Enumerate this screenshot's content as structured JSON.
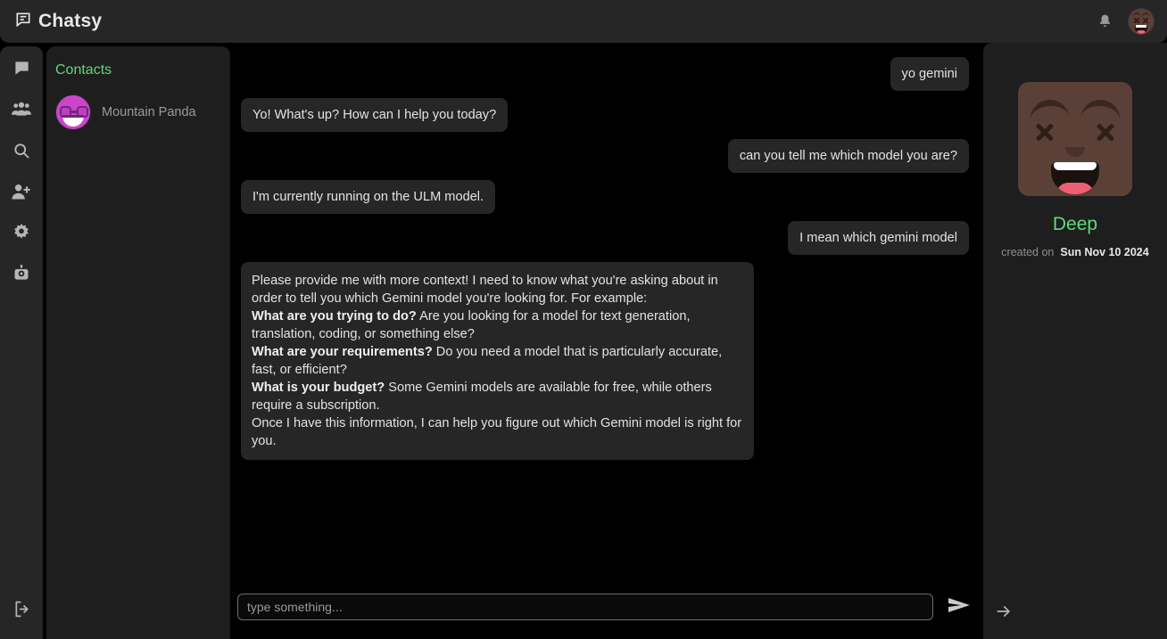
{
  "app": {
    "brand": "Chatsy",
    "brand_icon": "chat-bubble-icon",
    "bell_icon": "bell-icon",
    "user_avatar_icon": "user-avatar-dizzy-face"
  },
  "rail": {
    "items": [
      {
        "icon": "chat-bubble-icon",
        "name": "chats"
      },
      {
        "icon": "group-people-icon",
        "name": "groups"
      },
      {
        "icon": "search-icon",
        "name": "search"
      },
      {
        "icon": "add-person-icon",
        "name": "add-contact"
      },
      {
        "icon": "gear-icon",
        "name": "settings"
      },
      {
        "icon": "robot-icon",
        "name": "bots"
      }
    ],
    "logout": {
      "icon": "logout-icon",
      "name": "logout"
    }
  },
  "contacts": {
    "title": "Contacts",
    "items": [
      {
        "name": "Mountain Panda",
        "avatar_icon": "panda-glasses-avatar"
      }
    ]
  },
  "chat": {
    "messages": [
      {
        "from": "out",
        "text": "yo gemini"
      },
      {
        "from": "in",
        "text": "Yo! What's up? How can I help you today?"
      },
      {
        "from": "out",
        "text": "can you tell me which model you are?"
      },
      {
        "from": "in",
        "text": "I'm currently running on the ULM model."
      },
      {
        "from": "out",
        "text": "I mean which gemini model"
      },
      {
        "from": "in",
        "rich": true,
        "lines": [
          {
            "text": "Please provide me with more context! I need to know what you're asking about in order to tell you which Gemini model you're looking for. For example:"
          },
          {
            "bold": "What are you trying to do?",
            "text": " Are you looking for a model for text generation, translation, coding, or something else?"
          },
          {
            "bold": "What are your requirements?",
            "text": " Do you need a model that is particularly accurate, fast, or efficient?"
          },
          {
            "bold": "What is your budget?",
            "text": " Some Gemini models are available for free, while others require a subscription."
          },
          {
            "text": "Once I have this information, I can help you figure out which Gemini model is right for you."
          }
        ]
      }
    ]
  },
  "composer": {
    "placeholder": "type something...",
    "value": "",
    "send_icon": "send-paper-plane-icon"
  },
  "info": {
    "avatar_icon": "dizzy-face-avatar",
    "name": "Deep",
    "created_label": "created on",
    "created_date": "Sun Nov 10 2024",
    "collapse_icon": "arrow-right-icon"
  },
  "colors": {
    "accent_green": "#5cdb7c",
    "panel": "#1e1e1e",
    "header": "#262626",
    "bubble": "#262626",
    "chat_bg": "#000000",
    "contact_avatar": "#cc44cc",
    "profile_avatar": "#5b4038"
  }
}
